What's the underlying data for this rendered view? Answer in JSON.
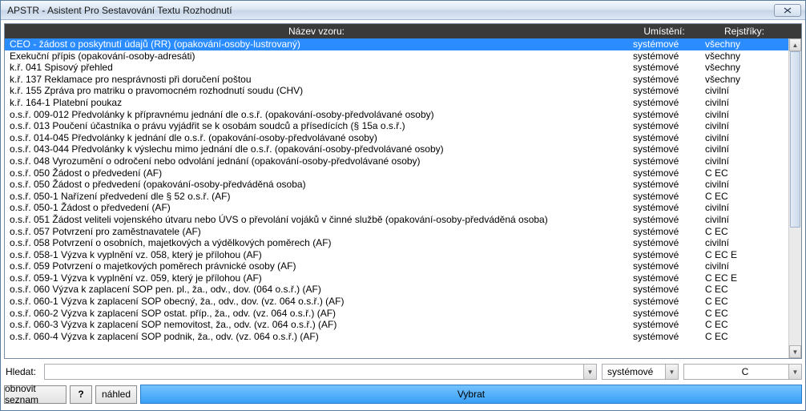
{
  "window": {
    "title": "APSTR - Asistent Pro Sestavování Textu Rozhodnutí"
  },
  "headers": {
    "name": "Název vzoru:",
    "location": "Umístění:",
    "registry": "Rejstříky:"
  },
  "rows": [
    {
      "name": "CEO - žádost o poskytnutí údajů (RR) (opakování-osoby-lustrovaný)",
      "loc": "systémové",
      "reg": "všechny",
      "selected": true
    },
    {
      "name": "Exekuční přípis (opakování-osoby-adresáti)",
      "loc": "systémové",
      "reg": "všechny"
    },
    {
      "name": "k.ř. 041 Spisový přehled",
      "loc": "systémové",
      "reg": "všechny"
    },
    {
      "name": "k.ř. 137 Reklamace pro nesprávnosti při doručení poštou",
      "loc": "systémové",
      "reg": "všechny"
    },
    {
      "name": "k.ř. 155 Zpráva pro matriku o pravomocném rozhodnutí soudu (CHV)",
      "loc": "systémové",
      "reg": "civilní"
    },
    {
      "name": "k.ř. 164-1 Platební poukaz",
      "loc": "systémové",
      "reg": "civilní"
    },
    {
      "name": "o.s.ř. 009-012 Předvolánky k přípravnému jednání dle o.s.ř. (opakování-osoby-předvolávané osoby)",
      "loc": "systémové",
      "reg": "civilní"
    },
    {
      "name": "o.s.ř. 013 Poučení účastníka o právu vyjádřit se k osobám soudců a přísedících (§ 15a o.s.ř.)",
      "loc": "systémové",
      "reg": "civilní"
    },
    {
      "name": "o.s.ř. 014-045 Předvolánky k jednání dle o.s.ř. (opakování-osoby-předvolávané osoby)",
      "loc": "systémové",
      "reg": "civilní"
    },
    {
      "name": "o.s.ř. 043-044 Předvolánky k výslechu mimo jednání dle o.s.ř. (opakování-osoby-předvolávané osoby)",
      "loc": "systémové",
      "reg": "civilní"
    },
    {
      "name": "o.s.ř. 048 Vyrozumění o odročení nebo odvolání jednání (opakování-osoby-předvolávané osoby)",
      "loc": "systémové",
      "reg": "civilní"
    },
    {
      "name": "o.s.ř. 050 Žádost o předvedení (AF)",
      "loc": "systémové",
      "reg": "C EC"
    },
    {
      "name": "o.s.ř. 050 Žádost o předvedení (opakování-osoby-předváděná osoba)",
      "loc": "systémové",
      "reg": "civilní"
    },
    {
      "name": "o.s.ř. 050-1 Nařízení předvedení dle § 52 o.s.ř. (AF)",
      "loc": "systémové",
      "reg": "C EC"
    },
    {
      "name": "o.s.ř. 050-1 Žádost o předvedení (AF)",
      "loc": "systémové",
      "reg": "civilní"
    },
    {
      "name": "o.s.ř. 051 Žádost veliteli vojenského útvaru nebo ÚVS o převolání vojáků v činné službě (opakování-osoby-předváděná osoba)",
      "loc": "systémové",
      "reg": "civilní"
    },
    {
      "name": "o.s.ř. 057 Potvrzení pro zaměstnavatele (AF)",
      "loc": "systémové",
      "reg": "C EC"
    },
    {
      "name": "o.s.ř. 058 Potvrzení o osobních, majetkových a výdělkových poměrech (AF)",
      "loc": "systémové",
      "reg": "civilní"
    },
    {
      "name": "o.s.ř. 058-1 Výzva k vyplnění vz. 058, který je přílohou (AF)",
      "loc": "systémové",
      "reg": "C EC E"
    },
    {
      "name": "o.s.ř. 059 Potvrzení o majetkových poměrech právnické osoby (AF)",
      "loc": "systémové",
      "reg": "civilní"
    },
    {
      "name": "o.s.ř. 059-1 Výzva k vyplnění vz. 059, který je přílohou (AF)",
      "loc": "systémové",
      "reg": "C EC E"
    },
    {
      "name": "o.s.ř. 060 Výzva k zaplacení SOP pen. pl., ža., odv., dov. (064 o.s.ř.) (AF)",
      "loc": "systémové",
      "reg": "C EC"
    },
    {
      "name": "o.s.ř. 060-1 Výzva k zaplacení SOP obecný, ža., odv., dov. (vz. 064 o.s.ř.) (AF)",
      "loc": "systémové",
      "reg": "C EC"
    },
    {
      "name": "o.s.ř. 060-2 Výzva k zaplacení SOP ostat. příp., ža., odv. (vz. 064 o.s.ř.) (AF)",
      "loc": "systémové",
      "reg": "C EC"
    },
    {
      "name": "o.s.ř. 060-3 Výzva k zaplacení SOP nemovitost, ža., odv. (vz. 064 o.s.ř.) (AF)",
      "loc": "systémové",
      "reg": "C EC"
    },
    {
      "name": "o.s.ř. 060-4 Výzva k zaplacení SOP podnik, ža., odv. (vz. 064 o.s.ř.) (AF)",
      "loc": "systémové",
      "reg": "C EC"
    }
  ],
  "search": {
    "label": "Hledat:",
    "value": ""
  },
  "filters": {
    "location": "systémové",
    "registry": "C"
  },
  "buttons": {
    "refresh": "obnovit seznam",
    "help": "?",
    "preview": "náhled",
    "select": "Vybrat"
  }
}
